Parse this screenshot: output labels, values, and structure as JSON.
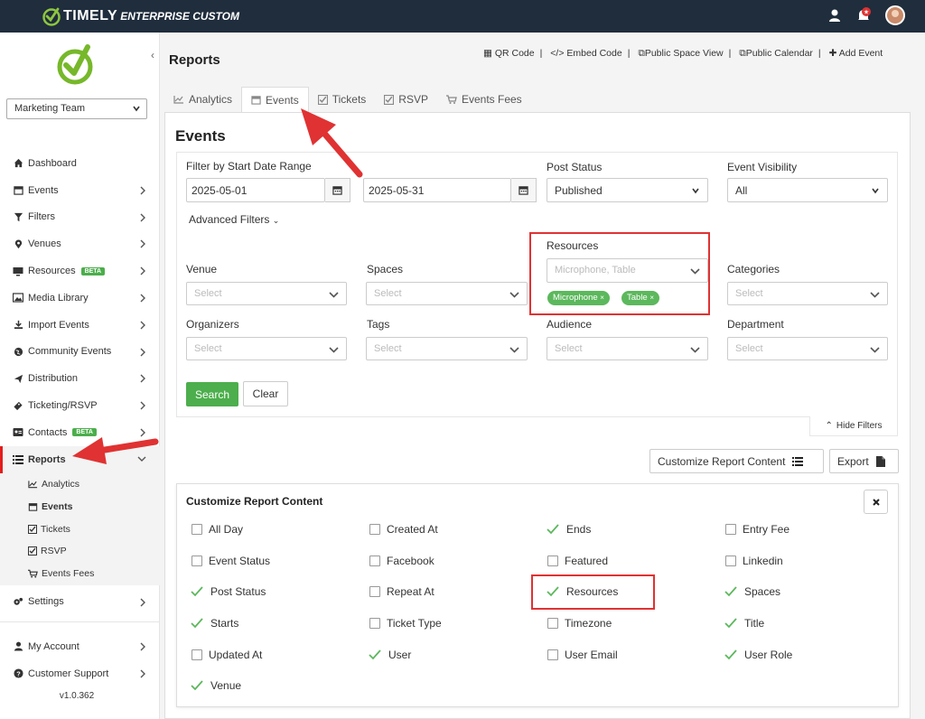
{
  "brand": {
    "name": "TIMELY",
    "edition": "ENTERPRISE CUSTOM"
  },
  "sidebar": {
    "team_select": "Marketing Team",
    "items": [
      {
        "label": "Dashboard",
        "icon": "home-icon"
      },
      {
        "label": "Events",
        "icon": "calendar-icon"
      },
      {
        "label": "Filters",
        "icon": "filter-icon"
      },
      {
        "label": "Venues",
        "icon": "map-pin-icon"
      },
      {
        "label": "Resources",
        "icon": "monitor-icon",
        "badge": "BETA"
      },
      {
        "label": "Media Library",
        "icon": "image-icon"
      },
      {
        "label": "Import Events",
        "icon": "download-icon"
      },
      {
        "label": "Community Events",
        "icon": "globe-icon"
      },
      {
        "label": "Distribution",
        "icon": "send-icon"
      },
      {
        "label": "Ticketing/RSVP",
        "icon": "ticket-icon"
      },
      {
        "label": "Contacts",
        "icon": "contact-card-icon",
        "badge": "BETA"
      },
      {
        "label": "Reports",
        "icon": "list-icon"
      }
    ],
    "report_sub": [
      {
        "label": "Analytics",
        "icon": "chart-icon"
      },
      {
        "label": "Events",
        "icon": "calendar-icon"
      },
      {
        "label": "Tickets",
        "icon": "checkbox-icon"
      },
      {
        "label": "RSVP",
        "icon": "checkbox-icon"
      },
      {
        "label": "Events Fees",
        "icon": "cart-icon"
      }
    ],
    "settings": "Settings",
    "my_account": "My Account",
    "customer_support": "Customer Support",
    "version": "v1.0.362"
  },
  "header": {
    "title": "Reports",
    "links": [
      "QR Code",
      "Embed Code",
      "Public Space View",
      "Public Calendar",
      "Add Event"
    ]
  },
  "tabs": [
    "Analytics",
    "Events",
    "Tickets",
    "RSVP",
    "Events Fees"
  ],
  "events": {
    "title": "Events",
    "date_label": "Filter by Start Date Range",
    "start_date": "2025-05-01",
    "end_date": "2025-05-31",
    "post_status_label": "Post Status",
    "post_status_value": "Published",
    "visibility_label": "Event Visibility",
    "visibility_value": "All",
    "advanced_filters": "Advanced Filters",
    "resources_label": "Resources",
    "resources_placeholder": "Microphone, Table",
    "resource_tags": [
      "Microphone",
      "Table"
    ],
    "venue_label": "Venue",
    "spaces_label": "Spaces",
    "categories_label": "Categories",
    "organizers_label": "Organizers",
    "tags_label": "Tags",
    "audience_label": "Audience",
    "department_label": "Department",
    "select_placeholder": "Select",
    "search_btn": "Search",
    "clear_btn": "Clear",
    "hide_filters": "Hide Filters",
    "customize_btn": "Customize Report Content",
    "export_btn": "Export"
  },
  "customize": {
    "title": "Customize Report Content",
    "options": [
      {
        "label": "All Day",
        "checked": false
      },
      {
        "label": "Created At",
        "checked": false
      },
      {
        "label": "Ends",
        "checked": true
      },
      {
        "label": "Entry Fee",
        "checked": false
      },
      {
        "label": "Event Status",
        "checked": false
      },
      {
        "label": "Facebook",
        "checked": false
      },
      {
        "label": "Featured",
        "checked": false
      },
      {
        "label": "Linkedin",
        "checked": false
      },
      {
        "label": "Post Status",
        "checked": true
      },
      {
        "label": "Repeat At",
        "checked": false
      },
      {
        "label": "Resources",
        "checked": true
      },
      {
        "label": "Spaces",
        "checked": true
      },
      {
        "label": "Starts",
        "checked": true
      },
      {
        "label": "Ticket Type",
        "checked": false
      },
      {
        "label": "Timezone",
        "checked": false
      },
      {
        "label": "Title",
        "checked": true
      },
      {
        "label": "Updated At",
        "checked": false
      },
      {
        "label": "User",
        "checked": true
      },
      {
        "label": "User Email",
        "checked": false
      },
      {
        "label": "User Role",
        "checked": true
      },
      {
        "label": "Venue",
        "checked": true
      }
    ]
  },
  "colors": {
    "topbar": "#1f2d3d",
    "brand_green": "#76b82a",
    "button_green": "#4cae4c",
    "annotation_red": "#e03232"
  }
}
